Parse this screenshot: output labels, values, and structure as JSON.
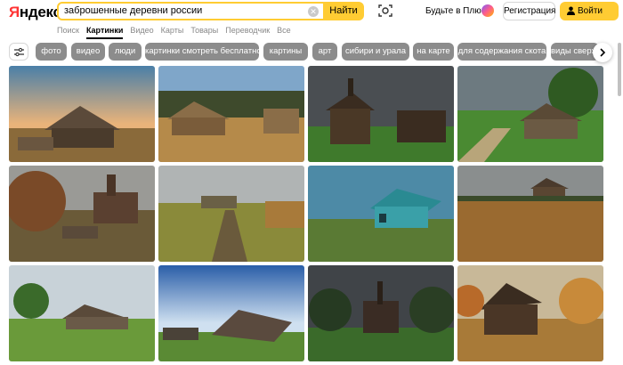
{
  "header": {
    "logo": "Яндекс",
    "search_query": "заброшенные деревни россии",
    "search_button": "Найти",
    "plus_text": "Будьте в Плюсе",
    "register_button": "Регистрация",
    "login_button": "Войти"
  },
  "tabs": [
    {
      "label": "Поиск",
      "active": false
    },
    {
      "label": "Картинки",
      "active": true
    },
    {
      "label": "Видео",
      "active": false
    },
    {
      "label": "Карты",
      "active": false
    },
    {
      "label": "Товары",
      "active": false
    },
    {
      "label": "Переводчик",
      "active": false
    },
    {
      "label": "Все",
      "active": false
    }
  ],
  "chips": [
    "фото",
    "видео",
    "люди",
    "картинки смотреть бесплатно",
    "картины",
    "арт",
    "сибири и урала",
    "на карте",
    "для содержания скота",
    "виды сверху"
  ],
  "colors": {
    "accent": "#ffcc33",
    "chip_bg": "#8c8c8c",
    "logo_red": "#ff3333"
  },
  "images": [
    {
      "name": "image-abandoned-house-sunset"
    },
    {
      "name": "image-wooden-houses-autumn-field"
    },
    {
      "name": "image-wooden-church-storm-clouds"
    },
    {
      "name": "image-old-house-green-meadow"
    },
    {
      "name": "image-ruined-church-autumn"
    },
    {
      "name": "image-dirt-road-village"
    },
    {
      "name": "image-teal-collapsed-house"
    },
    {
      "name": "image-house-dry-grass-field"
    },
    {
      "name": "image-village-meadow-houses"
    },
    {
      "name": "image-collapsed-barn-blue-sky"
    },
    {
      "name": "image-church-dark-sky"
    },
    {
      "name": "image-ruined-hut-autumn-trees"
    }
  ]
}
